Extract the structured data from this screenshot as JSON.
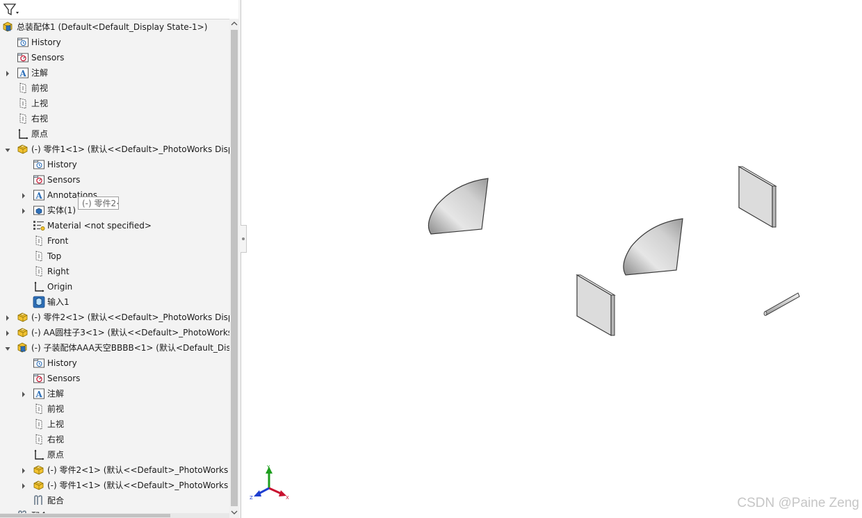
{
  "tree": {
    "rows": [
      {
        "label": "总装配体1  (Default<Default_Display State-1>)",
        "icon": "assembly",
        "indent": 0,
        "expand": "none"
      },
      {
        "label": "History",
        "icon": "history",
        "indent": 1,
        "expand": "none"
      },
      {
        "label": "Sensors",
        "icon": "sensor",
        "indent": 1,
        "expand": "none"
      },
      {
        "label": "注解",
        "icon": "annotation",
        "indent": 1,
        "expand": "collapsed"
      },
      {
        "label": "前视",
        "icon": "plane",
        "indent": 1,
        "expand": "none"
      },
      {
        "label": "上视",
        "icon": "plane",
        "indent": 1,
        "expand": "none"
      },
      {
        "label": "右视",
        "icon": "plane",
        "indent": 1,
        "expand": "none"
      },
      {
        "label": "原点",
        "icon": "origin",
        "indent": 1,
        "expand": "none"
      },
      {
        "label": "(-) 零件1<1> (默认<<Default>_PhotoWorks Disp",
        "icon": "part",
        "indent": 1,
        "expand": "expanded"
      },
      {
        "label": "History",
        "icon": "history",
        "indent": 2,
        "expand": "none"
      },
      {
        "label": "Sensors",
        "icon": "sensor",
        "indent": 2,
        "expand": "none"
      },
      {
        "label": "Annotations",
        "icon": "annotation",
        "indent": 2,
        "expand": "collapsed"
      },
      {
        "label": "实体(1)",
        "icon": "solid",
        "indent": 2,
        "expand": "collapsed"
      },
      {
        "label": "Material <not specified>",
        "icon": "material",
        "indent": 2,
        "expand": "none"
      },
      {
        "label": "Front",
        "icon": "plane",
        "indent": 2,
        "expand": "none"
      },
      {
        "label": "Top",
        "icon": "plane",
        "indent": 2,
        "expand": "none"
      },
      {
        "label": "Right",
        "icon": "plane",
        "indent": 2,
        "expand": "none"
      },
      {
        "label": "Origin",
        "icon": "origin",
        "indent": 2,
        "expand": "none"
      },
      {
        "label": "输入1",
        "icon": "import",
        "indent": 2,
        "expand": "none"
      },
      {
        "label": "(-) 零件2<1> (默认<<Default>_PhotoWorks Disp",
        "icon": "part",
        "indent": 1,
        "expand": "collapsed"
      },
      {
        "label": "(-) AA圆柱子3<1> (默认<<Default>_PhotoWorks",
        "icon": "part",
        "indent": 1,
        "expand": "collapsed"
      },
      {
        "label": "(-) 子装配体AAA天空BBBB<1> (默认<Default_Disp",
        "icon": "assembly",
        "indent": 1,
        "expand": "expanded"
      },
      {
        "label": "History",
        "icon": "history",
        "indent": 2,
        "expand": "none"
      },
      {
        "label": "Sensors",
        "icon": "sensor",
        "indent": 2,
        "expand": "none"
      },
      {
        "label": "注解",
        "icon": "annotation",
        "indent": 2,
        "expand": "collapsed"
      },
      {
        "label": "前视",
        "icon": "plane",
        "indent": 2,
        "expand": "none"
      },
      {
        "label": "上视",
        "icon": "plane",
        "indent": 2,
        "expand": "none"
      },
      {
        "label": "右视",
        "icon": "plane",
        "indent": 2,
        "expand": "none"
      },
      {
        "label": "原点",
        "icon": "origin",
        "indent": 2,
        "expand": "none"
      },
      {
        "label": "(-) 零件2<1> (默认<<Default>_PhotoWorks D",
        "icon": "part",
        "indent": 2,
        "expand": "collapsed"
      },
      {
        "label": "(-) 零件1<1> (默认<<Default>_PhotoWorks D",
        "icon": "part",
        "indent": 2,
        "expand": "collapsed"
      },
      {
        "label": "配合",
        "icon": "mate",
        "indent": 2,
        "expand": "none"
      },
      {
        "label": "配合",
        "icon": "mate",
        "indent": 1,
        "expand": "none"
      }
    ]
  },
  "tooltip": {
    "text": "(-) 零件2<"
  },
  "triad": {
    "x_label": "X",
    "y_label": "Y",
    "z_label": "Z",
    "x_color": "#c8102e",
    "y_color": "#1e9e1e",
    "z_color": "#1f3fd1"
  },
  "watermark": {
    "text": "CSDN @Paine Zeng"
  },
  "colors": {
    "panel_bg": "#f3f3f3",
    "icon_yellow": "#f2c230",
    "icon_blue": "#2d6fb8"
  }
}
